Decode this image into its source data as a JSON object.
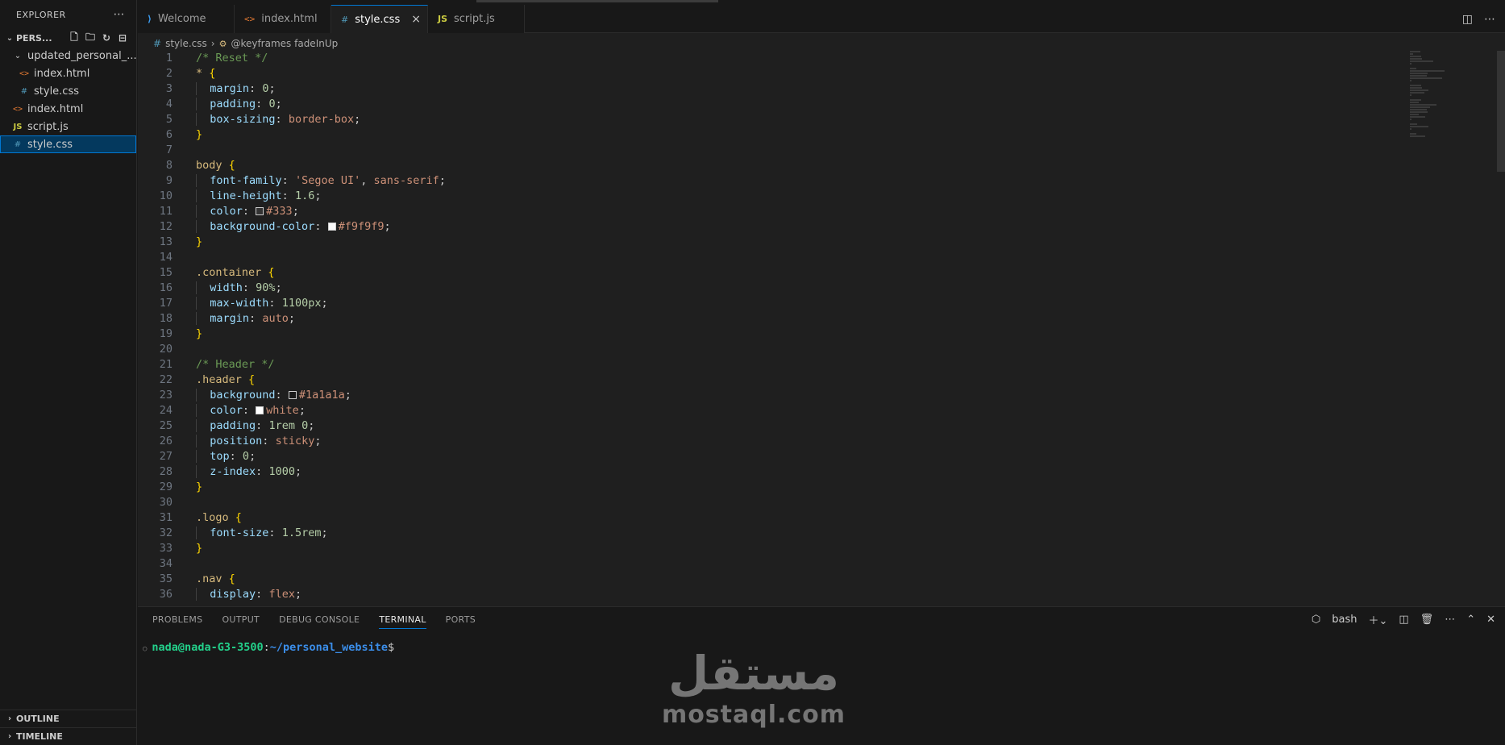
{
  "sidebar": {
    "title": "EXPLORER",
    "more": "⋯",
    "folder_name": "PERS...",
    "tree": [
      {
        "label": "updated_personal_...",
        "indent": 1,
        "type": "folder"
      },
      {
        "label": "index.html",
        "indent": 2,
        "type": "html"
      },
      {
        "label": "style.css",
        "indent": 2,
        "type": "css"
      },
      {
        "label": "index.html",
        "indent": 1,
        "type": "html"
      },
      {
        "label": "script.js",
        "indent": 1,
        "type": "js"
      },
      {
        "label": "style.css",
        "indent": 1,
        "type": "css",
        "selected": true
      }
    ],
    "outline": "OUTLINE",
    "timeline": "TIMELINE"
  },
  "tabs": [
    {
      "label": "Welcome",
      "icon": "vscode-icon"
    },
    {
      "label": "index.html",
      "icon": "html-file-icon"
    },
    {
      "label": "style.css",
      "icon": "css-file-icon",
      "active": true
    },
    {
      "label": "script.js",
      "icon": "js-file-icon"
    }
  ],
  "breadcrumb": {
    "file": "style.css",
    "symbol": "@keyframes fadeInUp"
  },
  "code_lines": [
    [
      {
        "t": "c",
        "v": "/* Reset */"
      }
    ],
    [
      {
        "t": "sel",
        "v": "* "
      },
      {
        "t": "br",
        "v": "{"
      }
    ],
    [
      {
        "t": "i",
        "v": "  "
      },
      {
        "t": "prop",
        "v": "margin"
      },
      {
        "t": "p",
        "v": ": "
      },
      {
        "t": "num",
        "v": "0"
      },
      {
        "t": "p",
        "v": ";"
      }
    ],
    [
      {
        "t": "i",
        "v": "  "
      },
      {
        "t": "prop",
        "v": "padding"
      },
      {
        "t": "p",
        "v": ": "
      },
      {
        "t": "num",
        "v": "0"
      },
      {
        "t": "p",
        "v": ";"
      }
    ],
    [
      {
        "t": "i",
        "v": "  "
      },
      {
        "t": "prop",
        "v": "box-sizing"
      },
      {
        "t": "p",
        "v": ": "
      },
      {
        "t": "val",
        "v": "border-box"
      },
      {
        "t": "p",
        "v": ";"
      }
    ],
    [
      {
        "t": "br",
        "v": "}"
      }
    ],
    [],
    [
      {
        "t": "sel",
        "v": "body "
      },
      {
        "t": "br",
        "v": "{"
      }
    ],
    [
      {
        "t": "i",
        "v": "  "
      },
      {
        "t": "prop",
        "v": "font-family"
      },
      {
        "t": "p",
        "v": ": "
      },
      {
        "t": "val",
        "v": "'Segoe UI'"
      },
      {
        "t": "p",
        "v": ", "
      },
      {
        "t": "val",
        "v": "sans-serif"
      },
      {
        "t": "p",
        "v": ";"
      }
    ],
    [
      {
        "t": "i",
        "v": "  "
      },
      {
        "t": "prop",
        "v": "line-height"
      },
      {
        "t": "p",
        "v": ": "
      },
      {
        "t": "num",
        "v": "1.6"
      },
      {
        "t": "p",
        "v": ";"
      }
    ],
    [
      {
        "t": "i",
        "v": "  "
      },
      {
        "t": "prop",
        "v": "color"
      },
      {
        "t": "p",
        "v": ": "
      },
      {
        "t": "sw",
        "v": "#333"
      },
      {
        "t": "val",
        "v": "#333"
      },
      {
        "t": "p",
        "v": ";"
      }
    ],
    [
      {
        "t": "i",
        "v": "  "
      },
      {
        "t": "prop",
        "v": "background-color"
      },
      {
        "t": "p",
        "v": ": "
      },
      {
        "t": "sw",
        "v": "#f9f9f9"
      },
      {
        "t": "val",
        "v": "#f9f9f9"
      },
      {
        "t": "p",
        "v": ";"
      }
    ],
    [
      {
        "t": "br",
        "v": "}"
      }
    ],
    [],
    [
      {
        "t": "sel",
        "v": ".container "
      },
      {
        "t": "br",
        "v": "{"
      }
    ],
    [
      {
        "t": "i",
        "v": "  "
      },
      {
        "t": "prop",
        "v": "width"
      },
      {
        "t": "p",
        "v": ": "
      },
      {
        "t": "num",
        "v": "90%"
      },
      {
        "t": "p",
        "v": ";"
      }
    ],
    [
      {
        "t": "i",
        "v": "  "
      },
      {
        "t": "prop",
        "v": "max-width"
      },
      {
        "t": "p",
        "v": ": "
      },
      {
        "t": "num",
        "v": "1100px"
      },
      {
        "t": "p",
        "v": ";"
      }
    ],
    [
      {
        "t": "i",
        "v": "  "
      },
      {
        "t": "prop",
        "v": "margin"
      },
      {
        "t": "p",
        "v": ": "
      },
      {
        "t": "val",
        "v": "auto"
      },
      {
        "t": "p",
        "v": ";"
      }
    ],
    [
      {
        "t": "br",
        "v": "}"
      }
    ],
    [],
    [
      {
        "t": "c",
        "v": "/* Header */"
      }
    ],
    [
      {
        "t": "sel",
        "v": ".header "
      },
      {
        "t": "br",
        "v": "{"
      }
    ],
    [
      {
        "t": "i",
        "v": "  "
      },
      {
        "t": "prop",
        "v": "background"
      },
      {
        "t": "p",
        "v": ": "
      },
      {
        "t": "sw",
        "v": "#1a1a1a"
      },
      {
        "t": "val",
        "v": "#1a1a1a"
      },
      {
        "t": "p",
        "v": ";"
      }
    ],
    [
      {
        "t": "i",
        "v": "  "
      },
      {
        "t": "prop",
        "v": "color"
      },
      {
        "t": "p",
        "v": ": "
      },
      {
        "t": "sw",
        "v": "#ffffff"
      },
      {
        "t": "val",
        "v": "white"
      },
      {
        "t": "p",
        "v": ";"
      }
    ],
    [
      {
        "t": "i",
        "v": "  "
      },
      {
        "t": "prop",
        "v": "padding"
      },
      {
        "t": "p",
        "v": ": "
      },
      {
        "t": "num",
        "v": "1rem"
      },
      {
        "t": "p",
        "v": " "
      },
      {
        "t": "num",
        "v": "0"
      },
      {
        "t": "p",
        "v": ";"
      }
    ],
    [
      {
        "t": "i",
        "v": "  "
      },
      {
        "t": "prop",
        "v": "position"
      },
      {
        "t": "p",
        "v": ": "
      },
      {
        "t": "val",
        "v": "sticky"
      },
      {
        "t": "p",
        "v": ";"
      }
    ],
    [
      {
        "t": "i",
        "v": "  "
      },
      {
        "t": "prop",
        "v": "top"
      },
      {
        "t": "p",
        "v": ": "
      },
      {
        "t": "num",
        "v": "0"
      },
      {
        "t": "p",
        "v": ";"
      }
    ],
    [
      {
        "t": "i",
        "v": "  "
      },
      {
        "t": "prop",
        "v": "z-index"
      },
      {
        "t": "p",
        "v": ": "
      },
      {
        "t": "num",
        "v": "1000"
      },
      {
        "t": "p",
        "v": ";"
      }
    ],
    [
      {
        "t": "br",
        "v": "}"
      }
    ],
    [],
    [
      {
        "t": "sel",
        "v": ".logo "
      },
      {
        "t": "br",
        "v": "{"
      }
    ],
    [
      {
        "t": "i",
        "v": "  "
      },
      {
        "t": "prop",
        "v": "font-size"
      },
      {
        "t": "p",
        "v": ": "
      },
      {
        "t": "num",
        "v": "1.5rem"
      },
      {
        "t": "p",
        "v": ";"
      }
    ],
    [
      {
        "t": "br",
        "v": "}"
      }
    ],
    [],
    [
      {
        "t": "sel",
        "v": ".nav "
      },
      {
        "t": "br",
        "v": "{"
      }
    ],
    [
      {
        "t": "i",
        "v": "  "
      },
      {
        "t": "prop",
        "v": "display"
      },
      {
        "t": "p",
        "v": ": "
      },
      {
        "t": "val",
        "v": "flex"
      },
      {
        "t": "p",
        "v": ";"
      }
    ]
  ],
  "panel": {
    "tabs": [
      "PROBLEMS",
      "OUTPUT",
      "DEBUG CONSOLE",
      "TERMINAL",
      "PORTS"
    ],
    "active_tab": "TERMINAL",
    "shell": "bash",
    "prompt_user": "nada@nada-G3-3500",
    "prompt_sep": ":",
    "prompt_path": "~/personal_website",
    "prompt_end": "$"
  },
  "watermark": {
    "arabic": "مستقل",
    "latin": "mostaql.com"
  },
  "colors": {
    "accent": "#0078d4",
    "html_icon": "#e37933",
    "css_icon": "#519aba",
    "js_icon": "#cbcb41",
    "terminal_user": "#23d18b",
    "terminal_path": "#3b8eea"
  }
}
